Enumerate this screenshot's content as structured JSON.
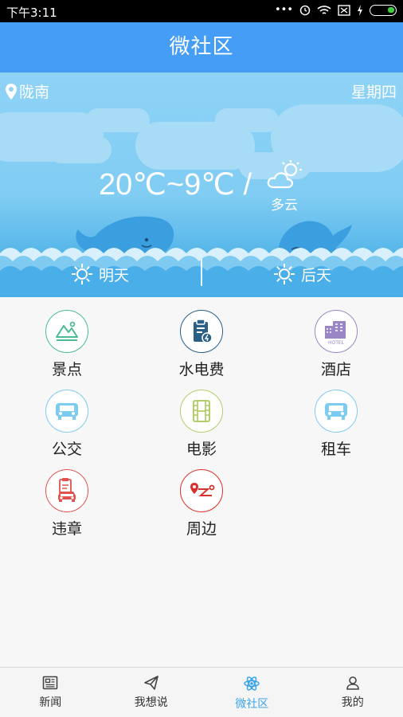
{
  "status_bar": {
    "time": "下午3:11",
    "dots": "•••"
  },
  "header": {
    "title": "微社区"
  },
  "weather": {
    "location": "陇南",
    "weekday": "星期四",
    "temperature": "20℃~9℃ /",
    "condition": "多云",
    "forecast": [
      "明天",
      "后天"
    ]
  },
  "services": [
    {
      "label": "景点",
      "icon": "scenic-icon",
      "color": "#4cbb92"
    },
    {
      "label": "水电费",
      "icon": "utility-bill-icon",
      "color": "#2a5f86"
    },
    {
      "label": "酒店",
      "icon": "hotel-icon",
      "color": "#9a86c4"
    },
    {
      "label": "公交",
      "icon": "bus-icon",
      "color": "#7ccbf0"
    },
    {
      "label": "电影",
      "icon": "film-icon",
      "color": "#b2cd6a"
    },
    {
      "label": "租车",
      "icon": "car-rental-icon",
      "color": "#7ccbf0"
    },
    {
      "label": "违章",
      "icon": "violation-icon",
      "color": "#e2524d"
    },
    {
      "label": "周边",
      "icon": "nearby-icon",
      "color": "#d9322e"
    }
  ],
  "tabs": [
    {
      "label": "新闻",
      "icon": "news-icon"
    },
    {
      "label": "我想说",
      "icon": "paper-plane-icon"
    },
    {
      "label": "微社区",
      "icon": "atom-icon",
      "active": true
    },
    {
      "label": "我的",
      "icon": "user-icon"
    }
  ],
  "colors": {
    "header": "#459df5",
    "active_tab": "#3aa4ea"
  }
}
